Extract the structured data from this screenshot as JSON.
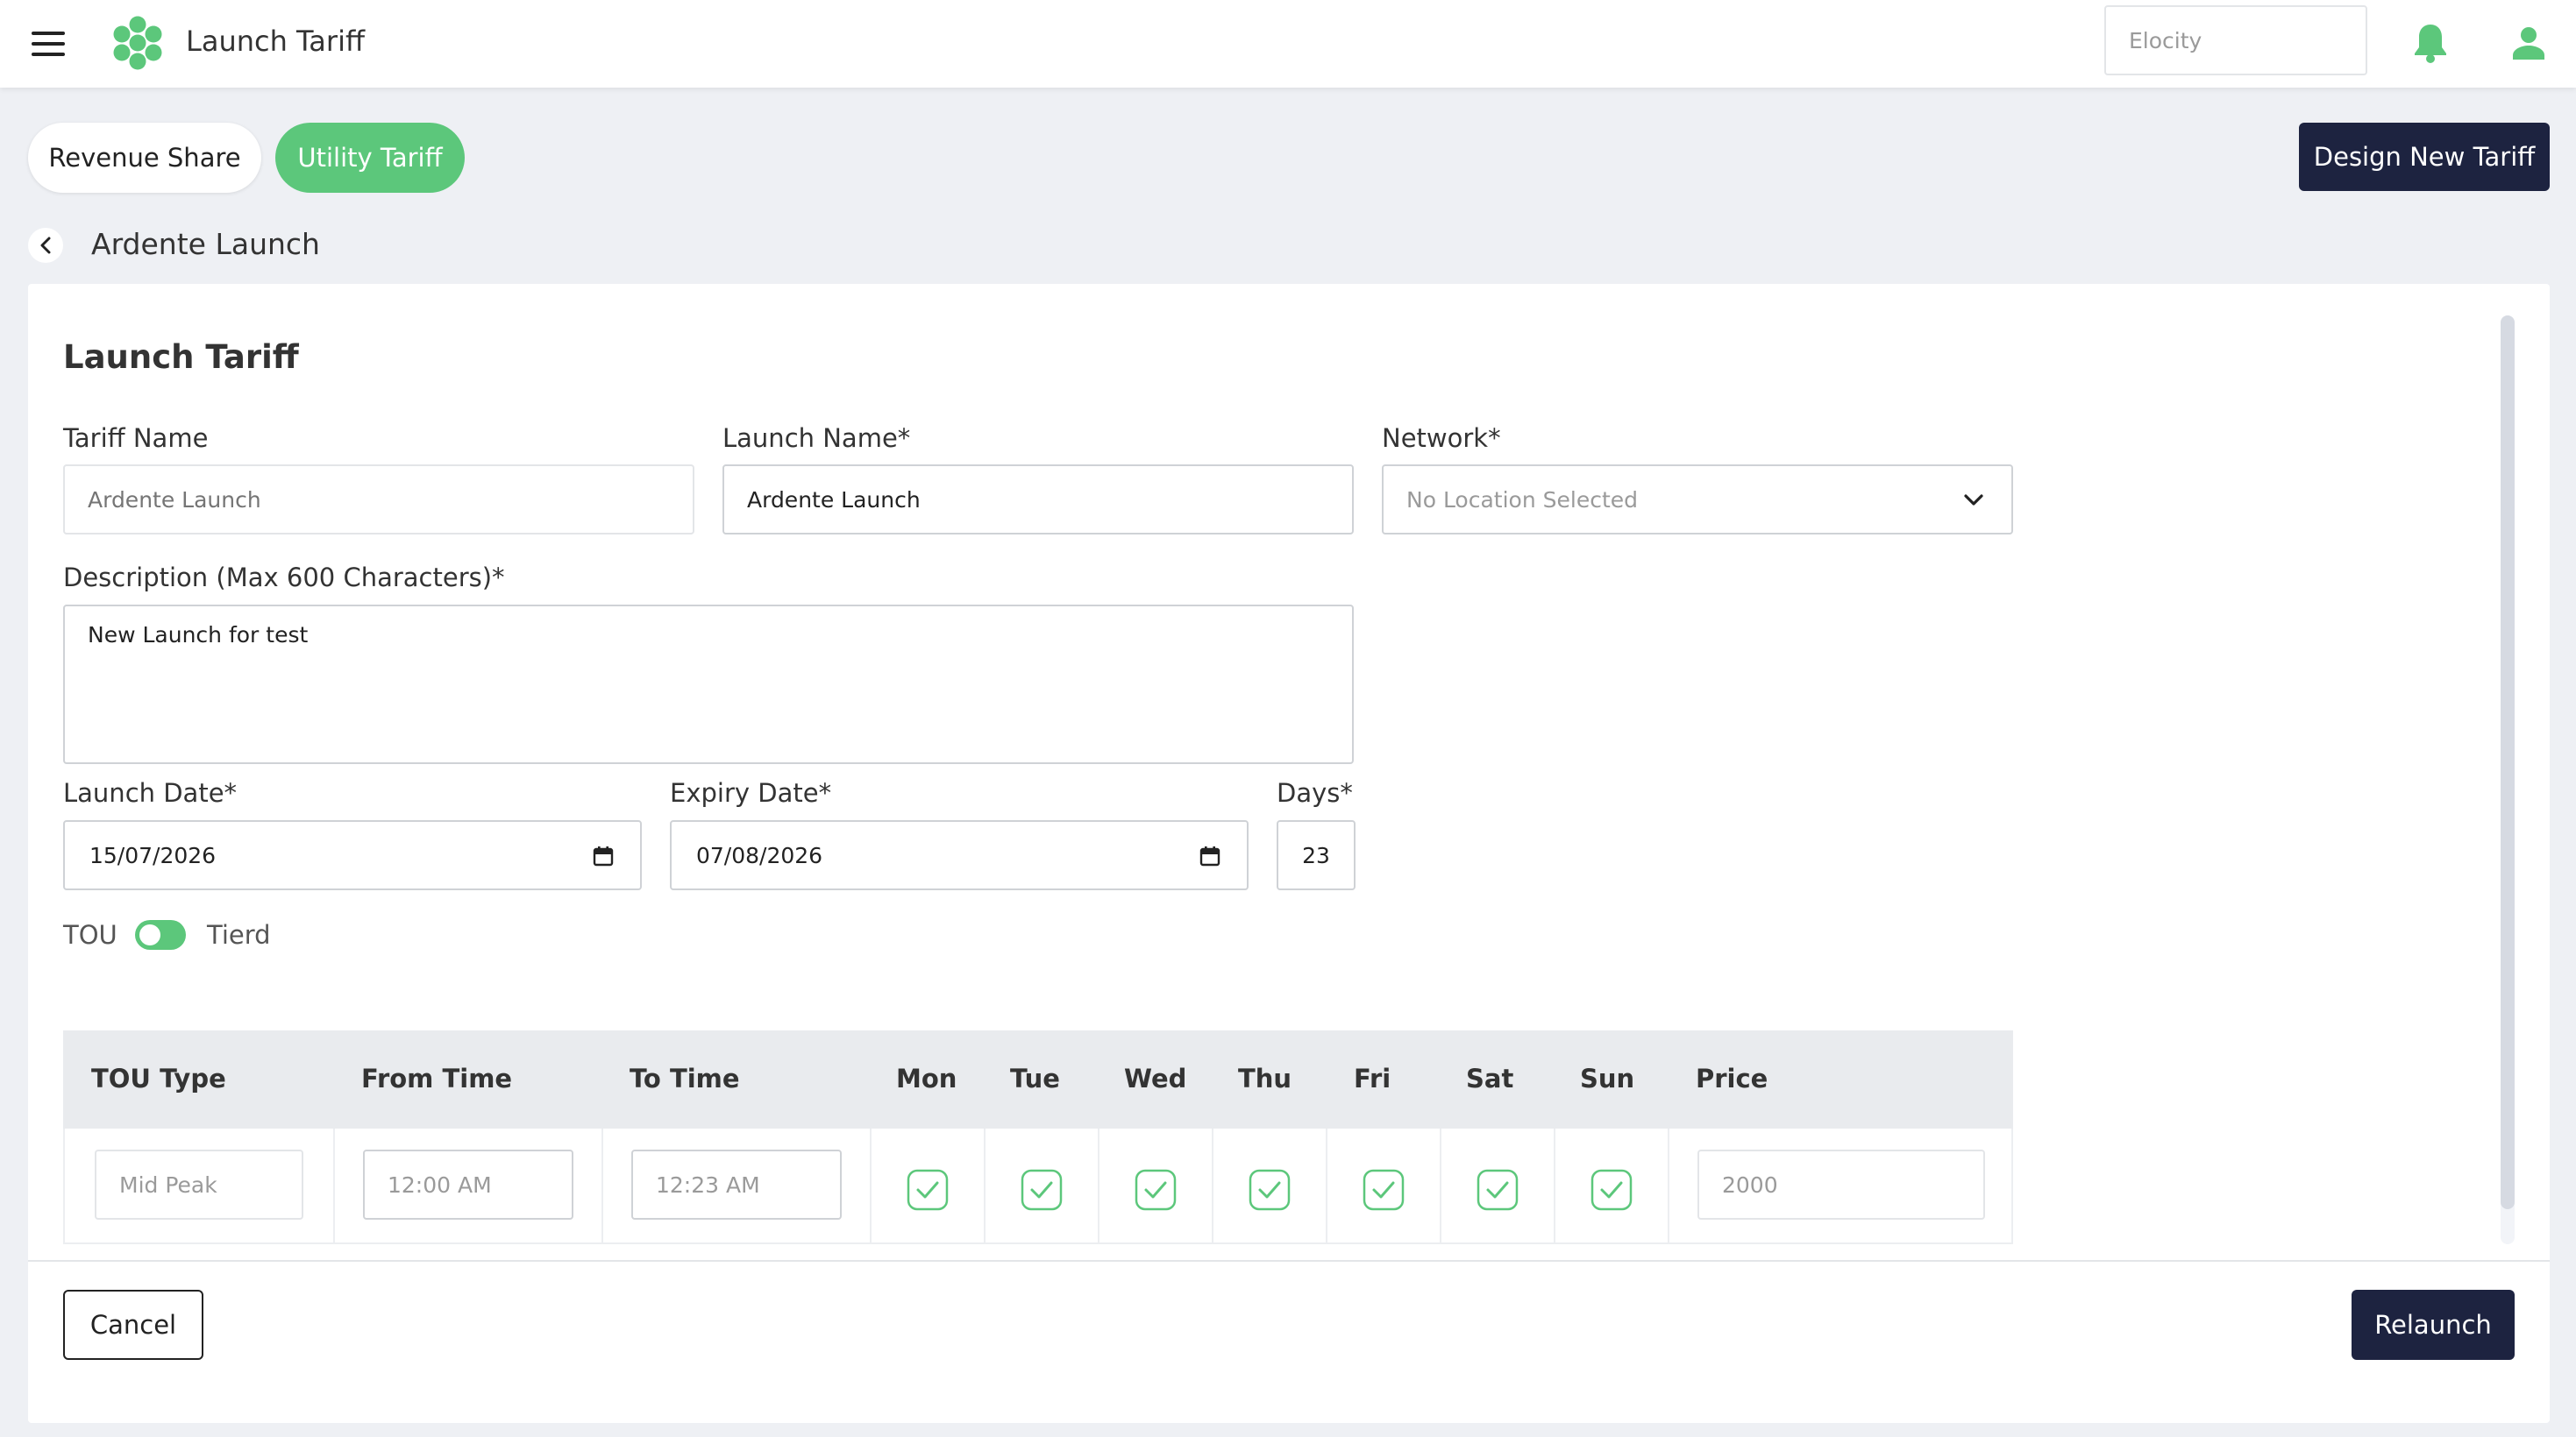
{
  "header": {
    "title": "Launch Tariff",
    "org_placeholder": "Elocity",
    "icons": [
      "menu-icon",
      "logo-icon",
      "bell-icon",
      "user-icon"
    ]
  },
  "tabs": [
    {
      "label": "Revenue Share",
      "active": false
    },
    {
      "label": "Utility Tariff",
      "active": true
    }
  ],
  "actions": {
    "design_new": "Design New Tariff"
  },
  "breadcrumb": {
    "title": "Ardente Launch"
  },
  "form": {
    "heading": "Launch Tariff",
    "tariff_name": {
      "label": "Tariff Name",
      "placeholder": "Ardente Launch"
    },
    "launch_name": {
      "label": "Launch Name*",
      "value": "Ardente Launch"
    },
    "network": {
      "label": "Network*",
      "placeholder": "No Location Selected"
    },
    "description": {
      "label": "Description (Max 600 Characters)*",
      "value": "New Launch for test"
    },
    "launch_date": {
      "label": "Launch Date*",
      "value": "15/07/2026"
    },
    "expiry_date": {
      "label": "Expiry Date*",
      "value": "07/08/2026"
    },
    "days": {
      "label": "Days*",
      "value": "23"
    },
    "toggle": {
      "left": "TOU",
      "right": "Tierd"
    }
  },
  "table": {
    "headers": [
      "TOU Type",
      "From Time",
      "To Time",
      "Mon",
      "Tue",
      "Wed",
      "Thu",
      "Fri",
      "Sat",
      "Sun",
      "Price"
    ],
    "rows": [
      {
        "tou_type": "Mid Peak",
        "from_time": "12:00  AM",
        "to_time": "12:23  AM",
        "days": [
          true,
          true,
          true,
          true,
          true,
          true,
          true
        ],
        "price": "2000"
      }
    ]
  },
  "footer": {
    "cancel": "Cancel",
    "relaunch": "Relaunch"
  },
  "colors": {
    "accent": "#5cc77b",
    "navy": "#1d2340",
    "background": "#eef0f4"
  }
}
